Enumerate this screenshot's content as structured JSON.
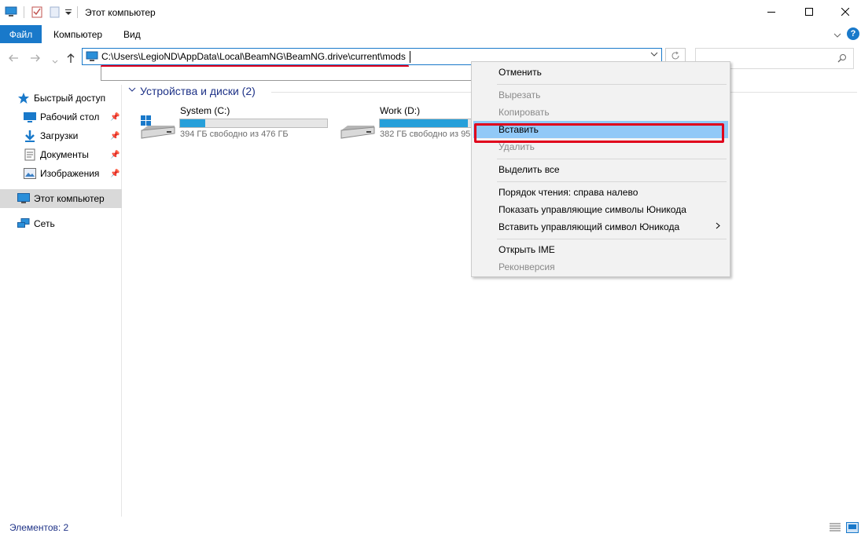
{
  "window": {
    "title": "Этот компьютер"
  },
  "ribbon": {
    "tabs": [
      "Файл",
      "Компьютер",
      "Вид"
    ]
  },
  "address": {
    "path": "C:\\Users\\LegioND\\AppData\\Local\\BeamNG\\BeamNG.drive\\current\\mods"
  },
  "search": {
    "placeholder": ""
  },
  "sidebar": {
    "items": [
      {
        "label": "Быстрый доступ",
        "icon": "star-icon"
      },
      {
        "label": "Рабочий стол",
        "icon": "desktop-icon",
        "pinned": true
      },
      {
        "label": "Загрузки",
        "icon": "download-icon",
        "pinned": true
      },
      {
        "label": "Документы",
        "icon": "documents-icon",
        "pinned": true
      },
      {
        "label": "Изображения",
        "icon": "pictures-icon",
        "pinned": true
      },
      {
        "label": "Этот компьютер",
        "icon": "computer-icon",
        "selected": true
      },
      {
        "label": "Сеть",
        "icon": "network-icon"
      }
    ]
  },
  "main": {
    "group_title": "Устройства и диски (2)",
    "drives": [
      {
        "name": "System (C:)",
        "info": "394 ГБ свободно из 476 ГБ",
        "used_fraction": 0.17,
        "icon": "windows-drive-icon"
      },
      {
        "name": "Work (D:)",
        "info": "382 ГБ свободно из 95",
        "used_fraction": 0.6,
        "icon": "drive-icon"
      }
    ]
  },
  "context_menu": {
    "items": [
      {
        "label": "Отменить",
        "disabled": false
      },
      {
        "label": "Вырезать",
        "disabled": true
      },
      {
        "label": "Копировать",
        "disabled": true
      },
      {
        "label": "Вставить",
        "disabled": false,
        "highlighted": true
      },
      {
        "label": "Удалить",
        "disabled": true
      },
      {
        "label": "Выделить все",
        "disabled": false
      },
      {
        "label": "Порядок чтения: справа налево",
        "disabled": false
      },
      {
        "label": "Показать управляющие символы Юникода",
        "disabled": false
      },
      {
        "label": "Вставить управляющий символ Юникода",
        "disabled": false,
        "submenu": true
      },
      {
        "label": "Открыть IME",
        "disabled": false
      },
      {
        "label": "Реконверсия",
        "disabled": true
      }
    ]
  },
  "status": {
    "text": "Элементов: 2"
  },
  "colors": {
    "accent": "#1979ca",
    "highlight": "#91c9f7",
    "annotation": "#e0001b",
    "drive_fill": "#26a0da"
  }
}
